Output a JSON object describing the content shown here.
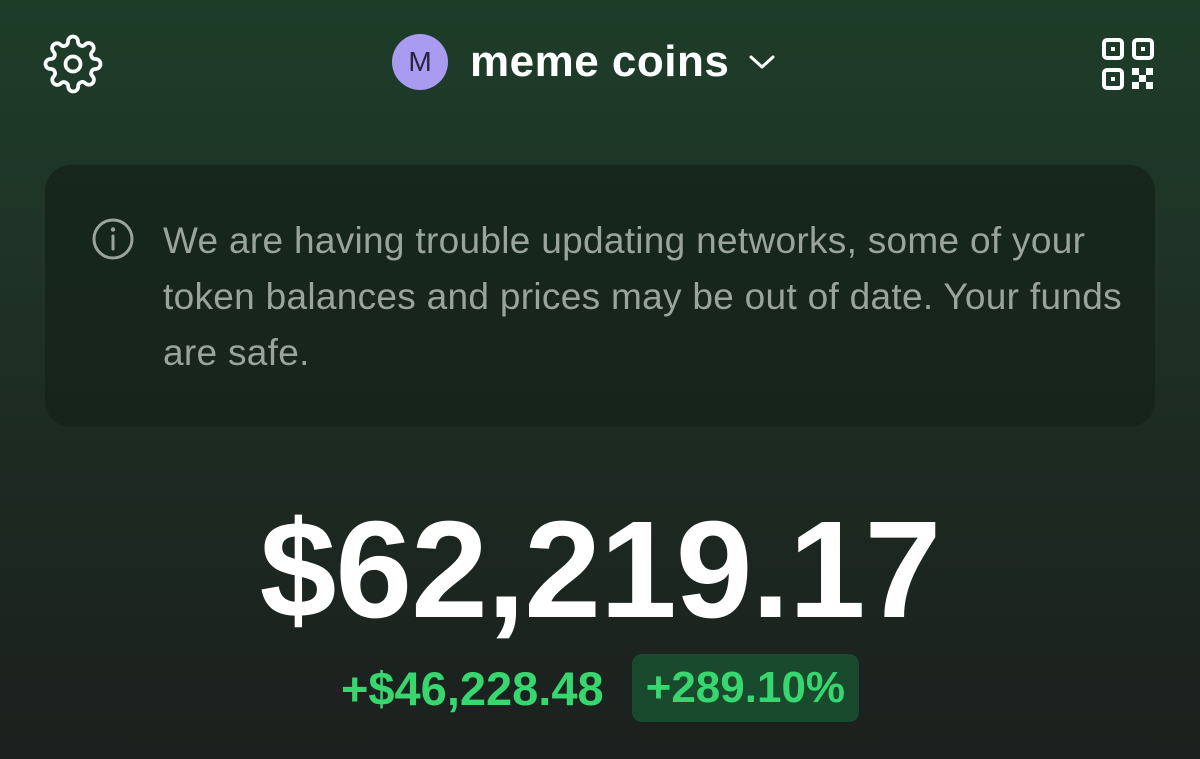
{
  "header": {
    "settings_icon": "gear-icon",
    "account": {
      "avatar_letter": "M",
      "avatar_color": "#a99bef",
      "name": "meme coins",
      "dropdown_icon": "chevron-down-icon"
    },
    "qr_icon": "qr-code-icon"
  },
  "notice": {
    "icon": "info-icon",
    "message": "We are having trouble updating networks, some of your token balances and prices may be out of date. Your funds are safe."
  },
  "portfolio": {
    "balance": "$62,219.17",
    "change_amount": "+$46,228.48",
    "change_percent": "+289.10%",
    "positive_color": "#37d66e"
  }
}
